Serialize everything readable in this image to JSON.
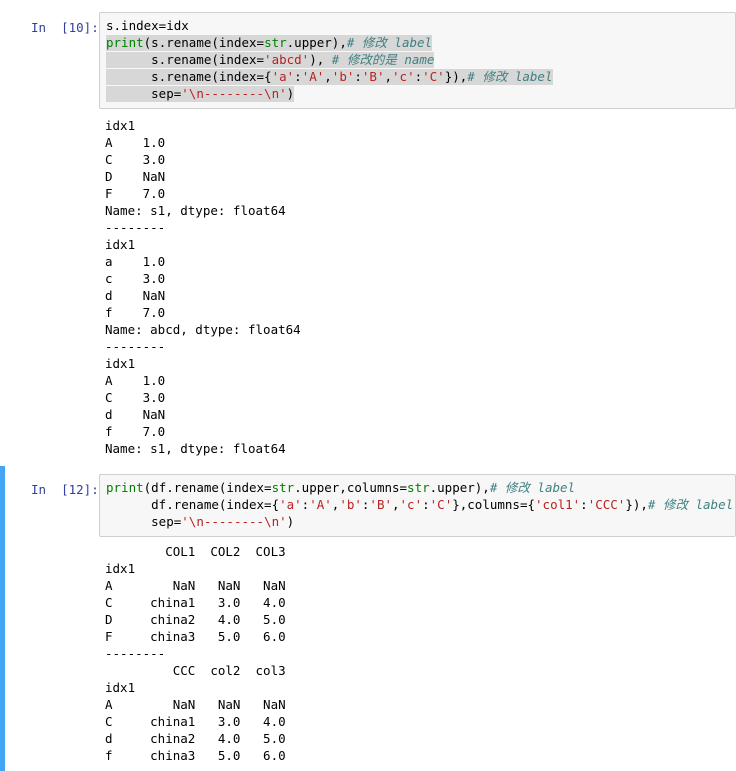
{
  "cell1": {
    "prompt": "In  [10]:",
    "code": [
      [
        {
          "t": "s.index=idx",
          "c": ""
        }
      ],
      [
        {
          "t": "print",
          "c": "kw-builtin"
        },
        {
          "t": "(s.rename(index=",
          "c": ""
        },
        {
          "t": "str",
          "c": "kw-builtin"
        },
        {
          "t": ".upper),",
          "c": ""
        },
        {
          "t": "# 修改 label",
          "c": "comment"
        }
      ],
      [
        {
          "t": "      s.rename(index=",
          "c": ""
        },
        {
          "t": "'abcd'",
          "c": "str"
        },
        {
          "t": "), ",
          "c": ""
        },
        {
          "t": "# 修改的是 name",
          "c": "comment"
        }
      ],
      [
        {
          "t": "      s.rename(index={",
          "c": ""
        },
        {
          "t": "'a'",
          "c": "str"
        },
        {
          "t": ":",
          "c": ""
        },
        {
          "t": "'A'",
          "c": "str"
        },
        {
          "t": ",",
          "c": ""
        },
        {
          "t": "'b'",
          "c": "str"
        },
        {
          "t": ":",
          "c": ""
        },
        {
          "t": "'B'",
          "c": "str"
        },
        {
          "t": ",",
          "c": ""
        },
        {
          "t": "'c'",
          "c": "str"
        },
        {
          "t": ":",
          "c": ""
        },
        {
          "t": "'C'",
          "c": "str"
        },
        {
          "t": "}),",
          "c": ""
        },
        {
          "t": "# 修改 label",
          "c": "comment"
        }
      ],
      [
        {
          "t": "      sep=",
          "c": ""
        },
        {
          "t": "'\\n--------\\n'",
          "c": "str"
        },
        {
          "t": ")",
          "c": ""
        }
      ]
    ],
    "output": [
      "idx1",
      "A    1.0",
      "C    3.0",
      "D    NaN",
      "F    7.0",
      "Name: s1, dtype: float64",
      "--------",
      "idx1",
      "a    1.0",
      "c    3.0",
      "d    NaN",
      "f    7.0",
      "Name: abcd, dtype: float64",
      "--------",
      "idx1",
      "A    1.0",
      "C    3.0",
      "d    NaN",
      "f    7.0",
      "Name: s1, dtype: float64"
    ]
  },
  "cell2": {
    "prompt": "In  [12]:",
    "code": [
      [
        {
          "t": "print",
          "c": "kw-builtin"
        },
        {
          "t": "(df.rename(index=",
          "c": ""
        },
        {
          "t": "str",
          "c": "kw-builtin"
        },
        {
          "t": ".upper,columns=",
          "c": ""
        },
        {
          "t": "str",
          "c": "kw-builtin"
        },
        {
          "t": ".upper),",
          "c": ""
        },
        {
          "t": "# 修改 label",
          "c": "comment"
        }
      ],
      [
        {
          "t": "      df.rename(index={",
          "c": ""
        },
        {
          "t": "'a'",
          "c": "str"
        },
        {
          "t": ":",
          "c": ""
        },
        {
          "t": "'A'",
          "c": "str"
        },
        {
          "t": ",",
          "c": ""
        },
        {
          "t": "'b'",
          "c": "str"
        },
        {
          "t": ":",
          "c": ""
        },
        {
          "t": "'B'",
          "c": "str"
        },
        {
          "t": ",",
          "c": ""
        },
        {
          "t": "'c'",
          "c": "str"
        },
        {
          "t": ":",
          "c": ""
        },
        {
          "t": "'C'",
          "c": "str"
        },
        {
          "t": "},columns={",
          "c": ""
        },
        {
          "t": "'col1'",
          "c": "str"
        },
        {
          "t": ":",
          "c": ""
        },
        {
          "t": "'CCC'",
          "c": "str"
        },
        {
          "t": "}),",
          "c": ""
        },
        {
          "t": "# 修改 label",
          "c": "comment"
        }
      ],
      [
        {
          "t": "      sep=",
          "c": ""
        },
        {
          "t": "'\\n--------\\n'",
          "c": "str"
        },
        {
          "t": ")",
          "c": ""
        }
      ]
    ],
    "output": [
      "        COL1  COL2  COL3",
      "idx1",
      "A        NaN   NaN   NaN",
      "C     china1   3.0   4.0",
      "D     china2   4.0   5.0",
      "F     china3   5.0   6.0",
      "--------",
      "         CCC  col2  col3",
      "idx1",
      "A        NaN   NaN   NaN",
      "C     china1   3.0   4.0",
      "d     china2   4.0   5.0",
      "f     china3   5.0   6.0"
    ]
  }
}
